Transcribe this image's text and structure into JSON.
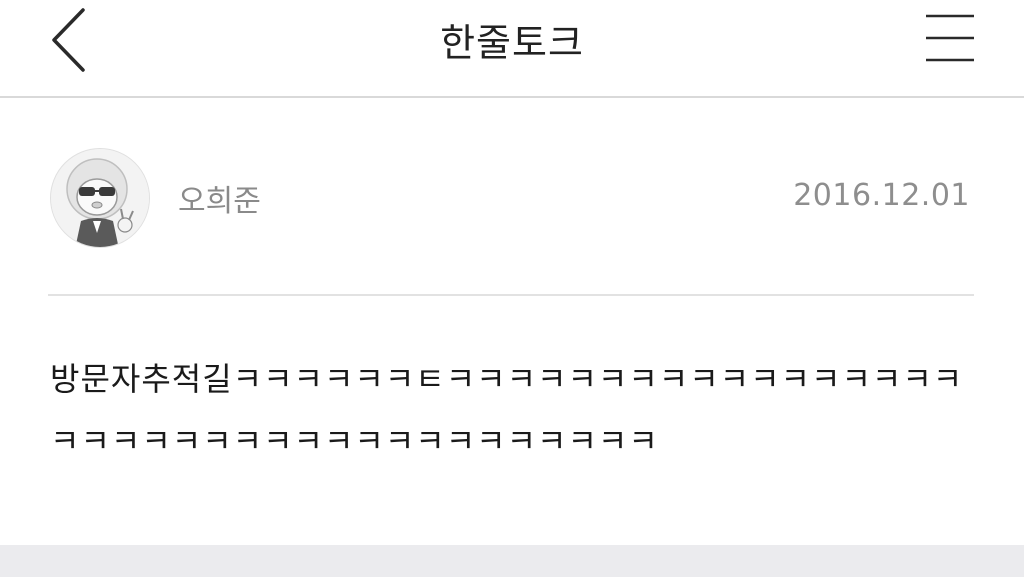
{
  "header": {
    "title": "한줄토크",
    "back_icon": "chevron-left-icon",
    "menu_icon": "hamburger-menu-icon"
  },
  "post": {
    "author": "오희준",
    "date": "2016.12.01",
    "avatar_icon": "profile-avatar-icon",
    "body": "방문자추적길ㅋㅋㅋㅋㅋㅋㅌㅋㅋㅋㅋㅋㅋㅋㅋㅋㅋㅋㅋㅋㅋㅋㅋㅋㅋㅋㅋㅋㅋㅋㅋㅋㅋㅋㅋㅋㅋㅋㅋㅋㅋㅋㅋㅋ"
  },
  "colors": {
    "title_text": "#222222",
    "meta_text": "#8a8a8a",
    "divider": "#d9d9d9",
    "footer": "#ebebee"
  }
}
